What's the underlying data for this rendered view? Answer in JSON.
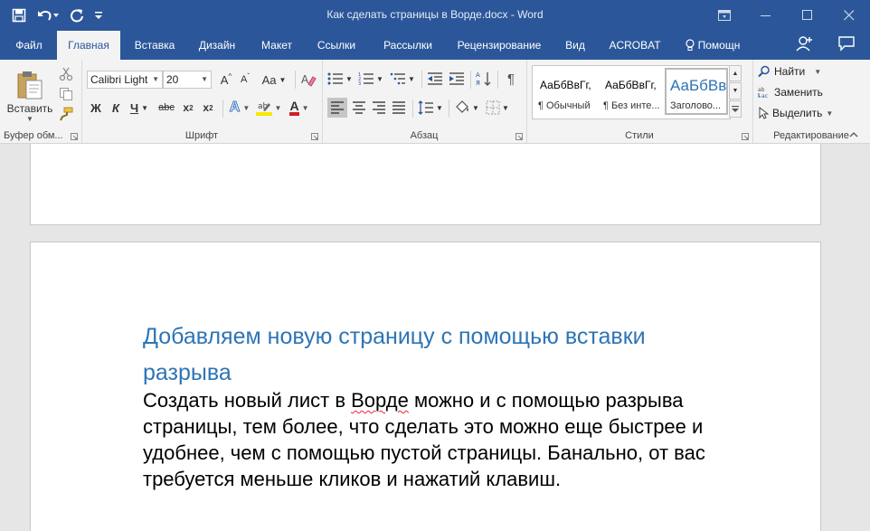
{
  "window": {
    "title": "Как сделать страницы в Ворде.docx - Word"
  },
  "qat": {
    "save_icon": "save-icon",
    "undo_icon": "undo-icon",
    "redo_icon": "repeat-icon",
    "customize_icon": "customize-icon"
  },
  "tabs": [
    {
      "label": "Файл"
    },
    {
      "label": "Главная"
    },
    {
      "label": "Вставка"
    },
    {
      "label": "Дизайн"
    },
    {
      "label": "Макет"
    },
    {
      "label": "Ссылки"
    },
    {
      "label": "Рассылки"
    },
    {
      "label": "Рецензирование"
    },
    {
      "label": "Вид"
    },
    {
      "label": "ACROBAT"
    },
    {
      "label": "Помощн"
    }
  ],
  "ribbon": {
    "clipboard": {
      "paste_label": "Вставить",
      "group_label": "Буфер обм..."
    },
    "font": {
      "font_name": "Calibri Light",
      "font_size": "20",
      "grow_label": "A",
      "shrink_label": "A",
      "case_label": "Aa",
      "bold": "Ж",
      "italic": "К",
      "underline": "Ч",
      "strike": "abc",
      "subscript": "x",
      "superscript": "x",
      "sub_mark": "2",
      "sup_mark": "2",
      "text_effects": "A",
      "font_color": "A",
      "group_label": "Шрифт"
    },
    "paragraph": {
      "group_label": "Абзац",
      "pilcrow": "¶"
    },
    "styles": {
      "group_label": "Стили",
      "items": [
        {
          "sample": "АаБбВвГг,",
          "name": "¶ Обычный"
        },
        {
          "sample": "АаБбВвГг,",
          "name": "¶ Без инте..."
        },
        {
          "sample": "АаБбВв",
          "name": "Заголово..."
        }
      ]
    },
    "editing": {
      "find": "Найти",
      "replace": "Заменить",
      "select": "Выделить",
      "group_label": "Редактирование"
    }
  },
  "document": {
    "heading": "Добавляем новую страницу с помощью вставки разрыва",
    "body_part1": "Создать новый лист в ",
    "body_misspelled": "Ворде",
    "body_part2": " можно и с помощью разрыва страницы, тем более, что сделать это можно еще быстрее и удобнее, чем с помощью пустой страницы. Банально, от вас требуется меньше кликов и нажатий клавиш."
  },
  "colors": {
    "title_bar": "#2b579a",
    "ribbon": "#f3f3f3",
    "heading": "#2e74b5"
  }
}
